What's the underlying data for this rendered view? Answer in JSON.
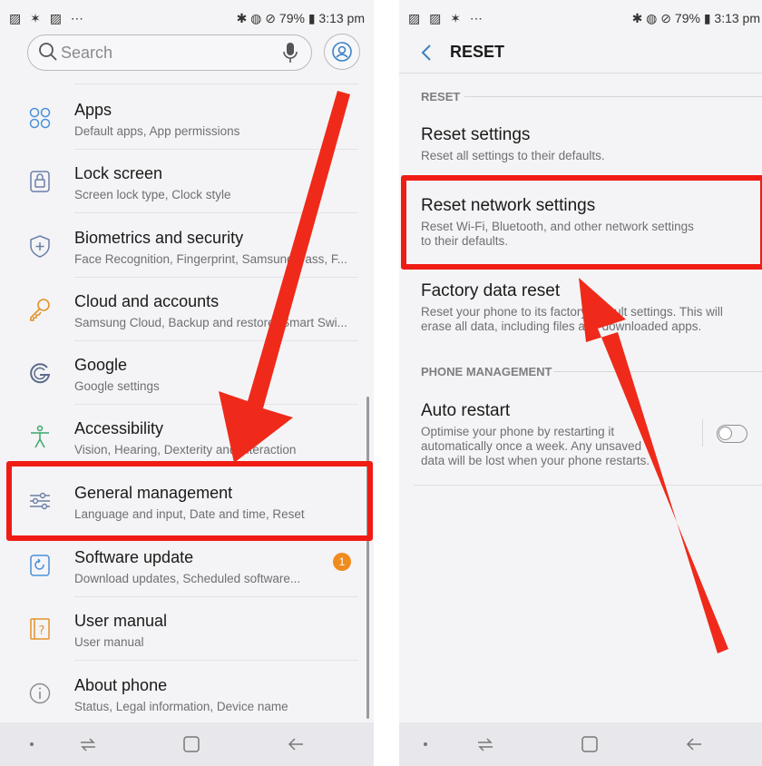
{
  "colors": {
    "highlight": "#ef1c15",
    "badge": "#f08b1e",
    "icon": "#4a90d9"
  },
  "left_phone": {
    "status": {
      "left_icons": "▨ ✶ ▨ ⋯",
      "right": "✱ ◍ ⊘ 79% ▮ 3:13 pm"
    },
    "search": {
      "placeholder": "Search"
    },
    "items": [
      {
        "title": "Apps",
        "subtitle": "Default apps, App permissions",
        "icon": "apps-icon"
      },
      {
        "title": "Lock screen",
        "subtitle": "Screen lock type, Clock style",
        "icon": "lock-icon"
      },
      {
        "title": "Biometrics and security",
        "subtitle": "Face Recognition, Fingerprint, Samsung Pass, F...",
        "icon": "shield-icon"
      },
      {
        "title": "Cloud and accounts",
        "subtitle": "Samsung Cloud, Backup and restore, Smart Swi...",
        "icon": "key-icon"
      },
      {
        "title": "Google",
        "subtitle": "Google settings",
        "icon": "google-icon"
      },
      {
        "title": "Accessibility",
        "subtitle": "Vision, Hearing, Dexterity and interaction",
        "icon": "accessibility-icon"
      },
      {
        "title": "General management",
        "subtitle": "Language and input, Date and time, Reset",
        "icon": "sliders-icon"
      },
      {
        "title": "Software update",
        "subtitle": "Download updates, Scheduled software...",
        "icon": "update-icon",
        "badge": "1"
      },
      {
        "title": "User manual",
        "subtitle": "User manual",
        "icon": "manual-icon"
      },
      {
        "title": "About phone",
        "subtitle": "Status, Legal information, Device name",
        "icon": "info-icon"
      }
    ]
  },
  "right_phone": {
    "status": {
      "left_icons": "▨ ▨ ✶ ⋯",
      "right": "✱ ◍ ⊘ 79% ▮ 3:13 pm"
    },
    "title": "RESET",
    "sections": {
      "reset": "RESET",
      "phone_management": "PHONE MANAGEMENT"
    },
    "reset_settings": {
      "title": "Reset settings",
      "subtitle": "Reset all settings to their defaults."
    },
    "reset_network": {
      "title": "Reset network settings",
      "subtitle_1": "Reset Wi-Fi, Bluetooth, and other network settings",
      "subtitle_2": "to their defaults."
    },
    "factory_reset": {
      "title": "Factory data reset",
      "subtitle_1": "Reset your phone to its factory default settings. This will",
      "subtitle_2": "erase all data, including files and downloaded apps."
    },
    "auto_restart": {
      "title": "Auto restart",
      "subtitle_1": "Optimise your phone by restarting it",
      "subtitle_2": "automatically once a week. Any unsaved",
      "subtitle_3": "data will be lost when your phone restarts.",
      "enabled": false
    }
  }
}
